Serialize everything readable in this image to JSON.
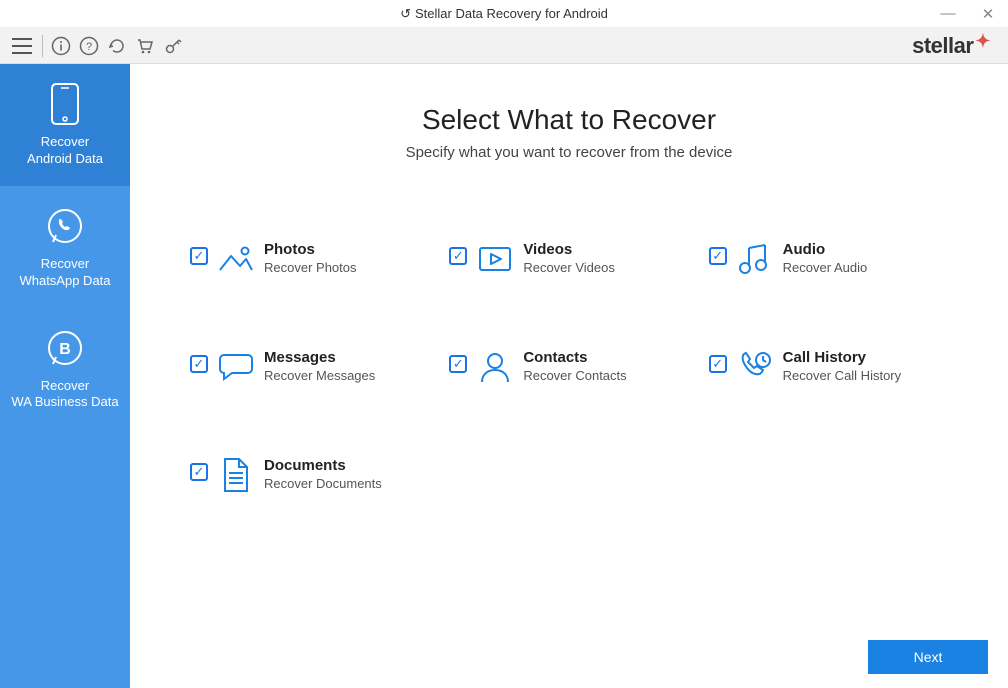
{
  "titlebar": {
    "title": "Stellar Data Recovery for Android"
  },
  "brand": "stellar",
  "sidebar": {
    "items": [
      {
        "line1": "Recover",
        "line2": "Android Data"
      },
      {
        "line1": "Recover",
        "line2": "WhatsApp Data"
      },
      {
        "line1": "Recover",
        "line2": "WA Business Data"
      }
    ]
  },
  "main": {
    "title": "Select What to Recover",
    "subtitle": "Specify what you want to recover from the device",
    "items": [
      {
        "title": "Photos",
        "desc": "Recover Photos"
      },
      {
        "title": "Videos",
        "desc": "Recover Videos"
      },
      {
        "title": "Audio",
        "desc": "Recover Audio"
      },
      {
        "title": "Messages",
        "desc": "Recover Messages"
      },
      {
        "title": "Contacts",
        "desc": "Recover Contacts"
      },
      {
        "title": "Call History",
        "desc": "Recover Call History"
      },
      {
        "title": "Documents",
        "desc": "Recover Documents"
      }
    ],
    "next": "Next"
  }
}
